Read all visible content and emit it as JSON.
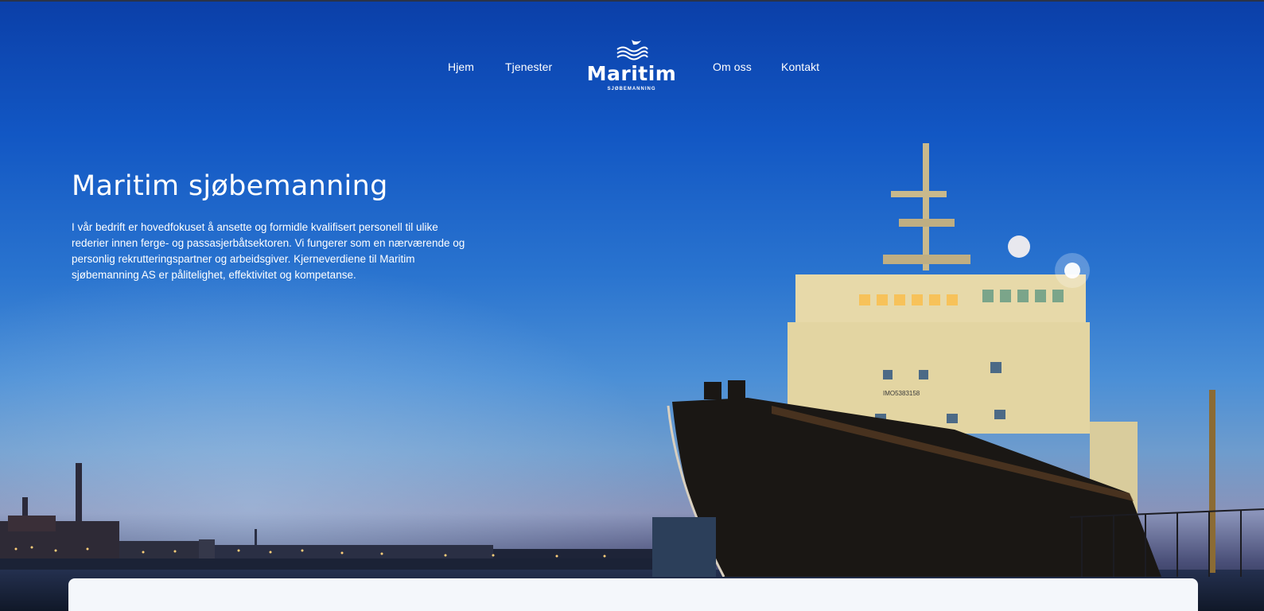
{
  "nav": {
    "items": [
      {
        "label": "Hjem"
      },
      {
        "label": "Tjenester"
      },
      {
        "label": "Om oss"
      },
      {
        "label": "Kontakt"
      }
    ]
  },
  "logo": {
    "word": "Maritim",
    "subtitle": "SJØBEMANNING"
  },
  "hero": {
    "title": "Maritim sjøbemanning",
    "intro": "I vår bedrift er hovedfokuset å ansette og formidle kvalifisert personell til ulike rederier innen ferge- og passasjerbåtsektoren. Vi fungerer som en nærværende og personlig rekrutteringspartner og arbeidsgiver. Kjerneverdiene til Maritim sjøbemanning AS er pålitelighet, effektivitet og kompetanse.",
    "ship_marking": "IMO5383158"
  },
  "colors": {
    "sky_top": "#0b3fa8",
    "sky_mid": "#4b8fd6",
    "text": "#ffffff",
    "card": "#f4f7fb"
  }
}
